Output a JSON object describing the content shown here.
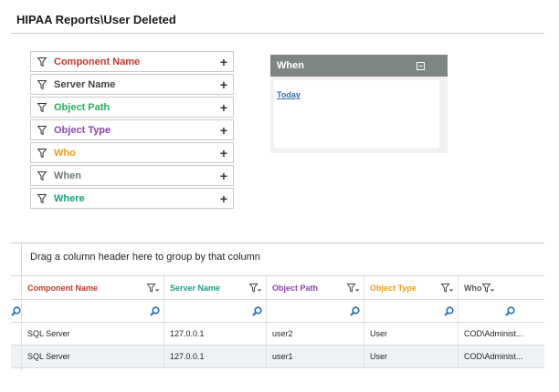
{
  "page": {
    "title": "HIPAA Reports\\User Deleted"
  },
  "filters": [
    {
      "label": "Component Name",
      "color": "#c0392b"
    },
    {
      "label": "Server Name",
      "color": "#444444"
    },
    {
      "label": "Object Path",
      "color": "#27ae60"
    },
    {
      "label": "Object Type",
      "color": "#8e44ad"
    },
    {
      "label": "Who",
      "color": "#f39c12"
    },
    {
      "label": "When",
      "color": "#6c7a72"
    },
    {
      "label": "Where",
      "color": "#16a085"
    }
  ],
  "when_panel": {
    "title": "When",
    "link": "Today"
  },
  "grid": {
    "group_hint": "Drag a column header here to group by that column",
    "columns": [
      {
        "label": "Component Name",
        "color": "#c0392b"
      },
      {
        "label": "Server Name",
        "color": "#16a085"
      },
      {
        "label": "Object Path",
        "color": "#8e44ad"
      },
      {
        "label": "Object Type",
        "color": "#f39c12"
      },
      {
        "label": "Who",
        "color": "#555555"
      }
    ],
    "rows": [
      [
        "SQL Server",
        "127.0.0.1",
        "user2",
        "User",
        "COD\\Administ..."
      ],
      [
        "SQL Server",
        "127.0.0.1",
        "user1",
        "User",
        "COD\\Administ..."
      ]
    ]
  },
  "colors": {
    "search_icon": "#1f6fb2",
    "when_header_bg": "#7e8683"
  }
}
